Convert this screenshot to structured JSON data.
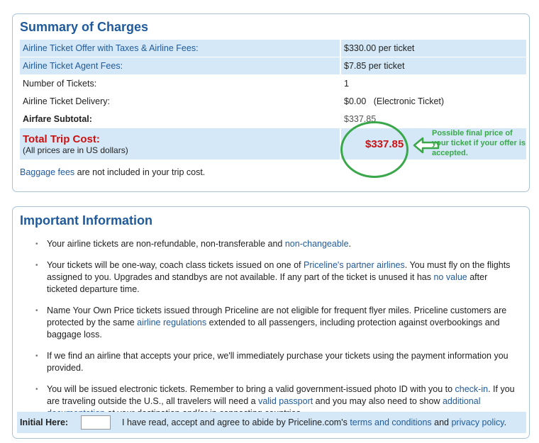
{
  "summary": {
    "title": "Summary of Charges",
    "rows": [
      {
        "label": "Airline Ticket Offer with Taxes & Airline Fees:",
        "value": "$330.00 per ticket"
      },
      {
        "label": "Airline Ticket Agent Fees:",
        "value": "$7.85 per ticket"
      },
      {
        "label": "Number of Tickets:",
        "value": "1"
      },
      {
        "label": "Airline Ticket Delivery:",
        "value": "$0.00   (Electronic Ticket)"
      },
      {
        "label": "Airfare Subtotal:",
        "value": "$337.85"
      }
    ],
    "total_label": "Total Trip Cost:",
    "total_sub": "(All prices are in US dollars)",
    "total_price": "$337.85",
    "baggage_link": "Baggage fees",
    "baggage_text": " are not included in your trip cost.",
    "annotation_note": "Possible final price of your ticket if your offer is accepted.",
    "annotation_color": "#3aa84a"
  },
  "info": {
    "title": "Important Information",
    "b1_t1": "Your airline tickets are non-refundable, non-transferable and ",
    "b1_link": "non-changeable",
    "b1_t2": ".",
    "b2_t1": "Your tickets will be one-way, coach class tickets issued on one of ",
    "b2_link1": "Priceline's partner airlines",
    "b2_t2": ". You must fly on the flights assigned to you. Upgrades and standbys are not available. If any part of the ticket is unused it has ",
    "b2_link2": "no value",
    "b2_t3": " after ticketed departure time.",
    "b3_t1": "Name Your Own Price tickets issued through Priceline are not eligible for frequent flyer miles. Priceline customers are protected by the same ",
    "b3_link": "airline regulations",
    "b3_t2": " extended to all passengers, including protection against overbookings and baggage loss.",
    "b4_t1": "If we find an airline that accepts your price, we'll immediately purchase your tickets using the payment information you provided.",
    "b5_t1": "You will be issued electronic tickets. Remember to bring a valid government-issued photo ID with you to ",
    "b5_link1": "check-in",
    "b5_t2": ". If you are traveling outside the U.S., all travelers will need a ",
    "b5_link2": "valid passport",
    "b5_t3": " and you may also need to show ",
    "b5_link3": "additional documentation",
    "b5_t4": " at your destination and/or in connecting countries.",
    "initial_label": "Initial Here:",
    "initial_value": "",
    "agree_t1": "I have read, accept and agree to abide by Priceline.com's ",
    "agree_link1": "terms and conditions",
    "agree_t2": " and ",
    "agree_link2": "privacy policy",
    "agree_t3": "."
  }
}
